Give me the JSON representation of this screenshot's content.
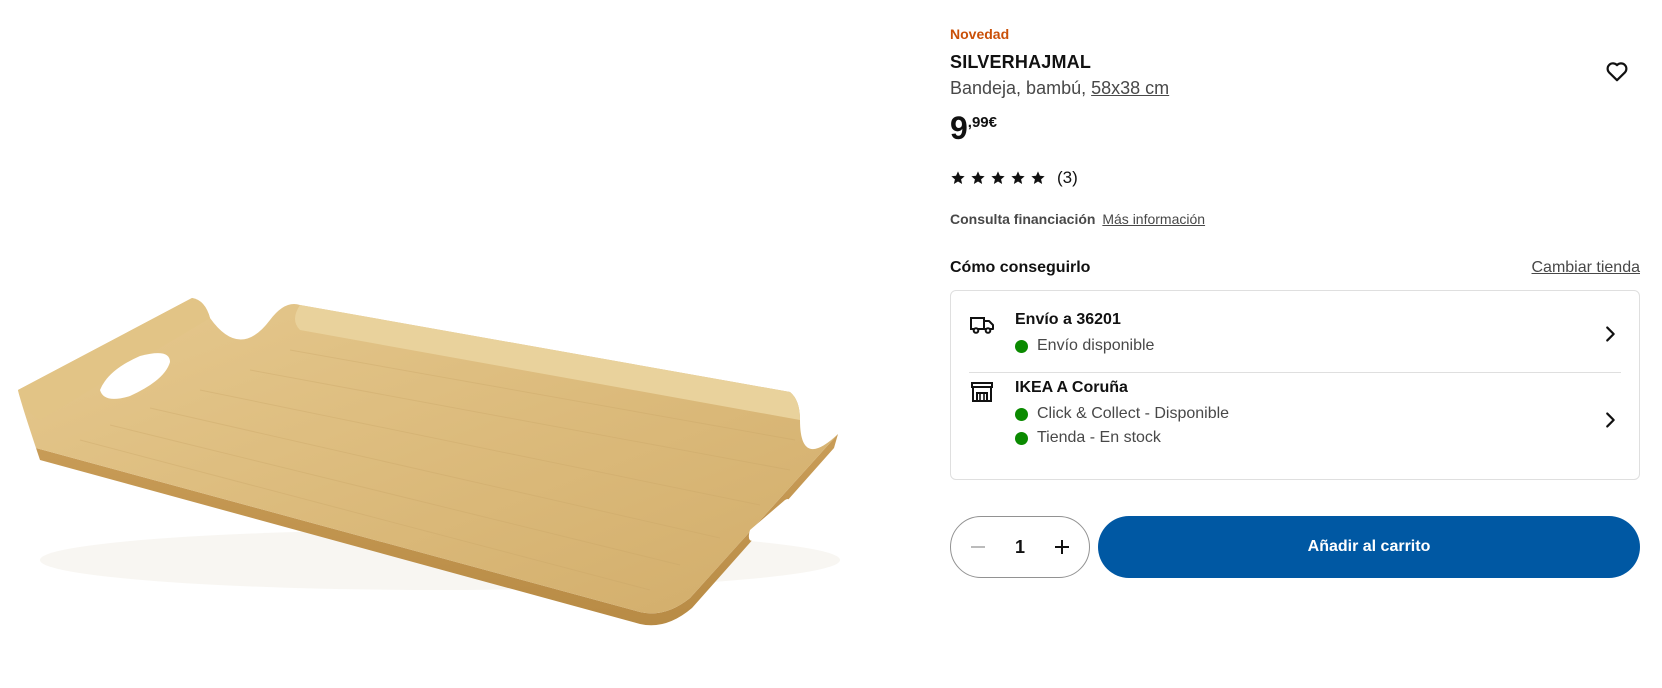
{
  "product": {
    "badge": "Novedad",
    "name": "SILVERHAJMAL",
    "description": "Bandeja, bambú,",
    "size": "58x38 cm",
    "price_integer": "9",
    "price_decimal": ",99€",
    "rating_stars": 5,
    "rating_count": "(3)",
    "image_icon": "bamboo-tray-image"
  },
  "financing": {
    "label": "Consulta financiación",
    "link": "Más información"
  },
  "availability": {
    "title": "Cómo conseguirlo",
    "change_store": "Cambiar tienda",
    "delivery": {
      "title": "Envío a 36201",
      "status": "Envío disponible",
      "icon": "truck-icon"
    },
    "store": {
      "title": "IKEA A Coruña",
      "status_1": "Click & Collect - Disponible",
      "status_2": "Tienda - En stock",
      "icon": "store-icon"
    },
    "status_color": "#0a8a00"
  },
  "cart": {
    "quantity": "1",
    "add_label": "Añadir al carrito",
    "button_color": "#0058a3"
  }
}
